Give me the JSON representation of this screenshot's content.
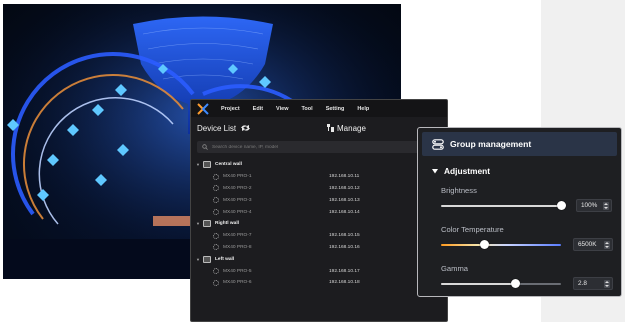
{
  "app": {
    "menu": [
      "Project",
      "Edit",
      "View",
      "Tool",
      "Setting",
      "Help"
    ],
    "device_list_title": "Device List",
    "manage_label": "Manage",
    "search_placeholder": "Search device name, IP, model"
  },
  "tree": [
    {
      "group": "Central wall",
      "devices": [
        {
          "name": "MX40 PRO-1",
          "ip": "192.168.10.11"
        },
        {
          "name": "MX40 PRO-2",
          "ip": "192.168.10.12"
        },
        {
          "name": "MX40 PRO-3",
          "ip": "192.168.10.13"
        },
        {
          "name": "MX40 PRO-4",
          "ip": "192.168.10.14"
        }
      ]
    },
    {
      "group": "Rightl wall",
      "devices": [
        {
          "name": "MX40 PRO-7",
          "ip": "192.168.10.15"
        },
        {
          "name": "MX40 PRO-8",
          "ip": "192.168.10.16"
        }
      ]
    },
    {
      "group": "Left wall",
      "devices": [
        {
          "name": "MX40 PRO-5",
          "ip": "192.168.10.17"
        },
        {
          "name": "MX40 PRO-6",
          "ip": "192.168.10.18"
        }
      ]
    }
  ],
  "group_panel": {
    "title": "Group management",
    "section": "Adjustment",
    "brightness": {
      "label": "Brightness",
      "value": "100%",
      "level": 1.0
    },
    "color_temperature": {
      "label": "Color Temperature",
      "value": "6500K",
      "level": 0.36
    },
    "gamma": {
      "label": "Gamma",
      "value": "2.8",
      "level": 0.62
    }
  },
  "colors": {
    "accent": "#2a3447",
    "stage_blue": "#1f5cff",
    "slider_thumb": "#ffffff"
  },
  "icons": [
    "app-logo-icon",
    "refresh-icon",
    "manage-icon",
    "search-icon",
    "group-management-icon",
    "caret-down-icon",
    "device-icon"
  ]
}
